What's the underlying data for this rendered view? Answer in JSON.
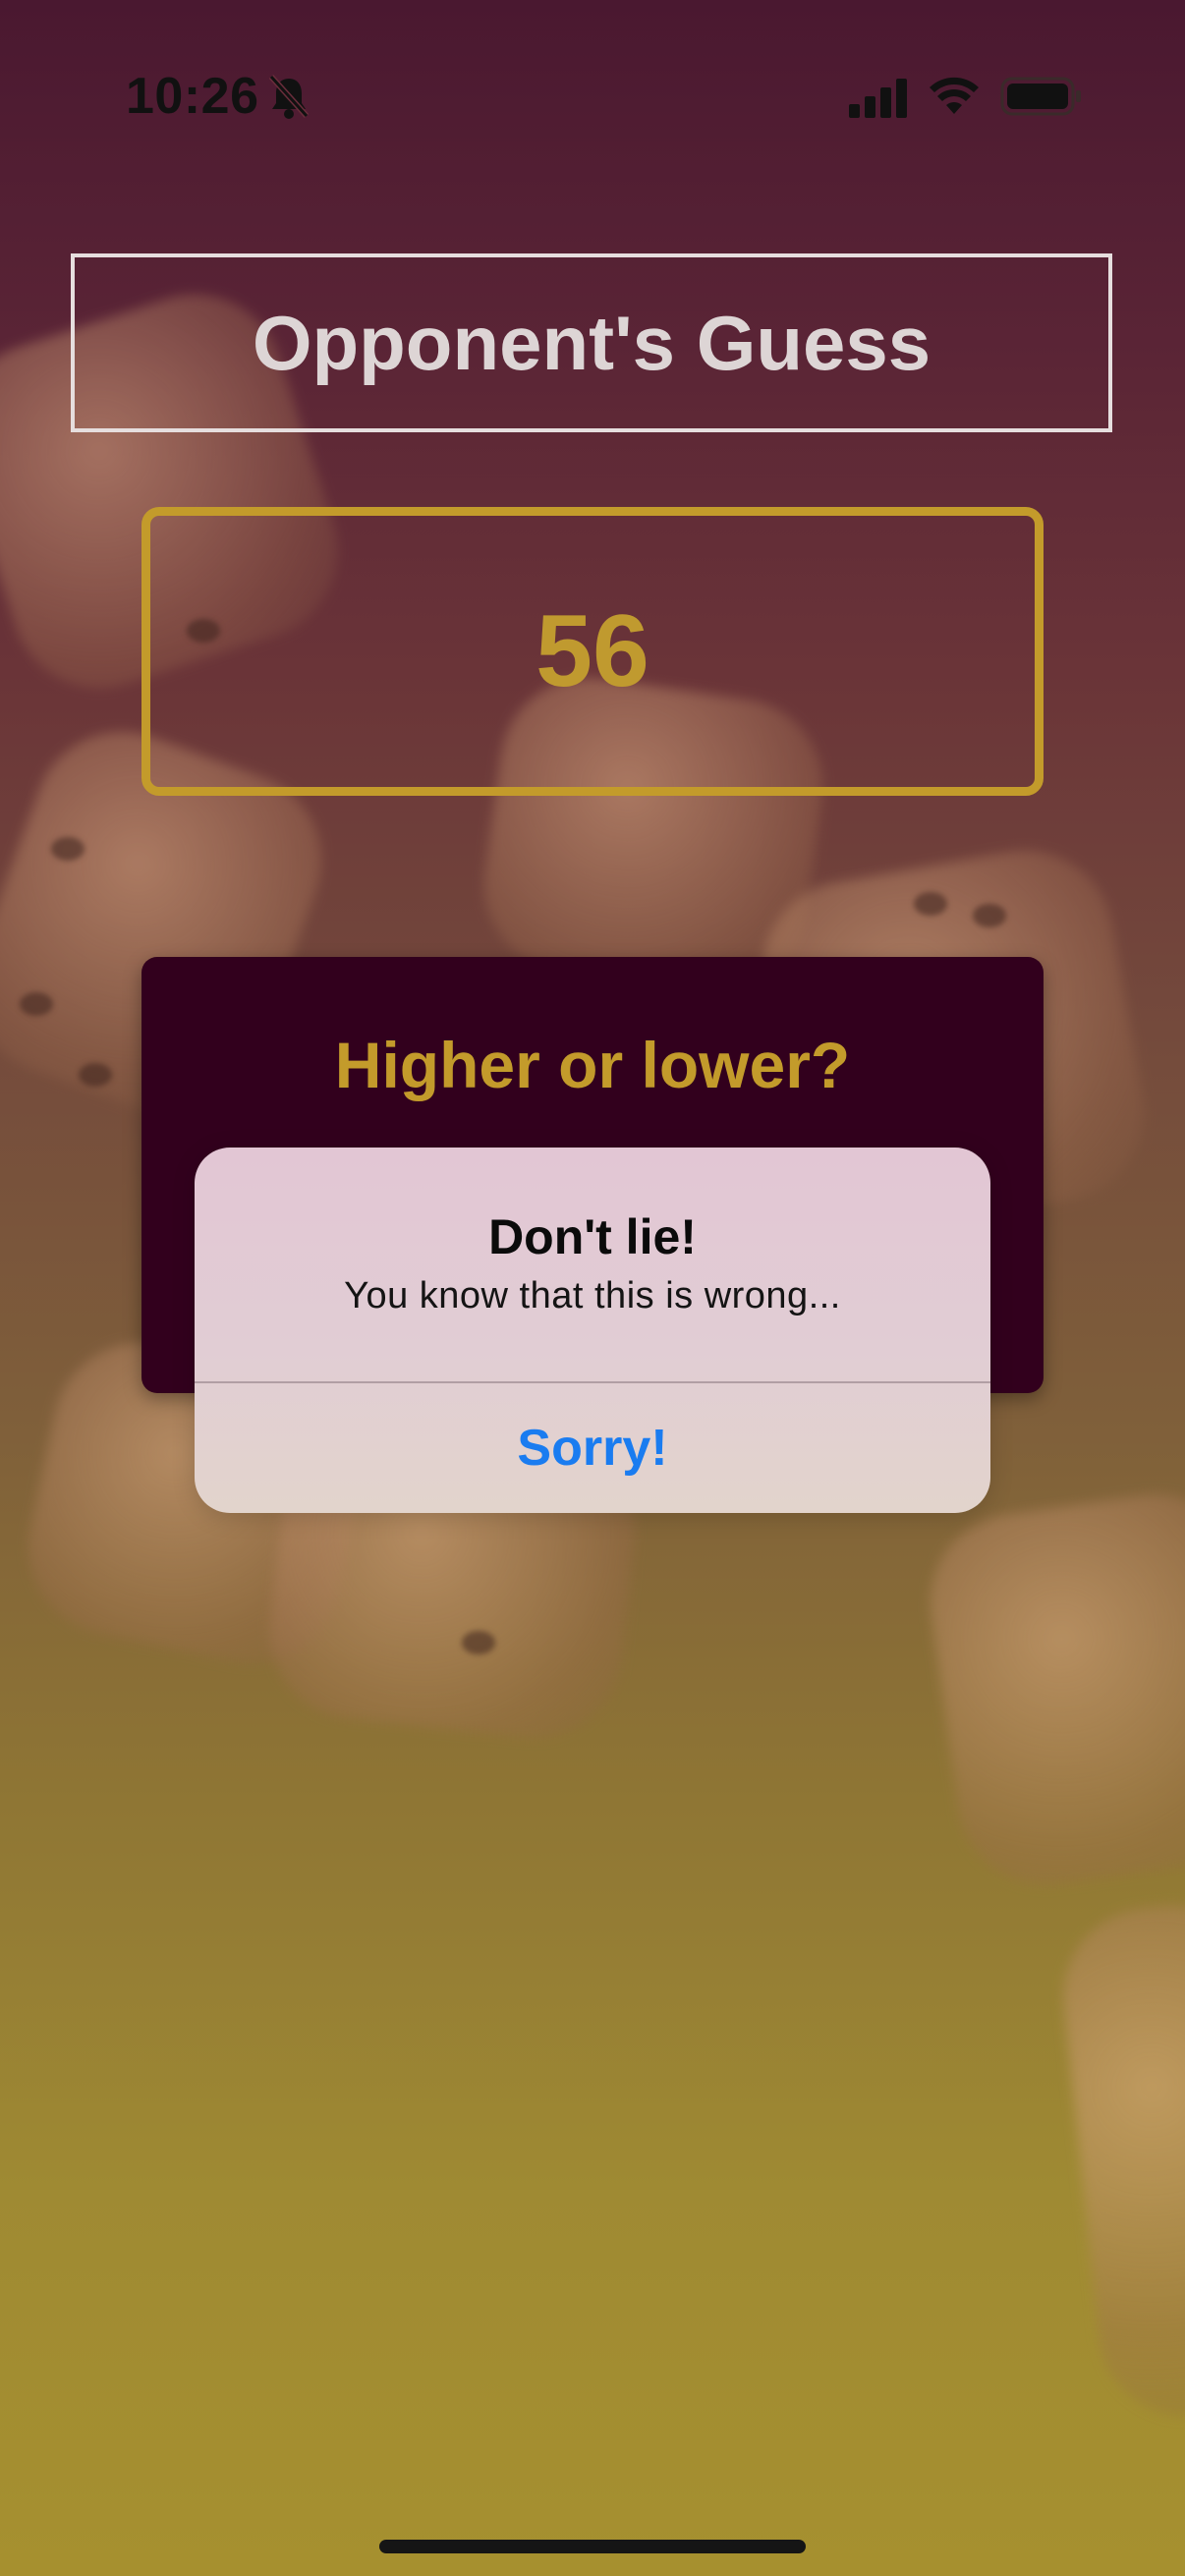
{
  "status_bar": {
    "time": "10:26",
    "icons": [
      "bell-slash-icon",
      "cellular-signal-icon",
      "wifi-icon",
      "battery-icon"
    ]
  },
  "screen": {
    "title": "Opponent's Guess",
    "guess": "56",
    "hint_prompt": "Higher or lower?"
  },
  "alert": {
    "title": "Don't lie!",
    "message": "You know that this is wrong...",
    "button_label": "Sorry!"
  },
  "colors": {
    "accent_gold": "#c39b2b",
    "card_background": "#32001d",
    "alert_button_blue": "#1a7cf0",
    "title_border": "#e6dede"
  }
}
